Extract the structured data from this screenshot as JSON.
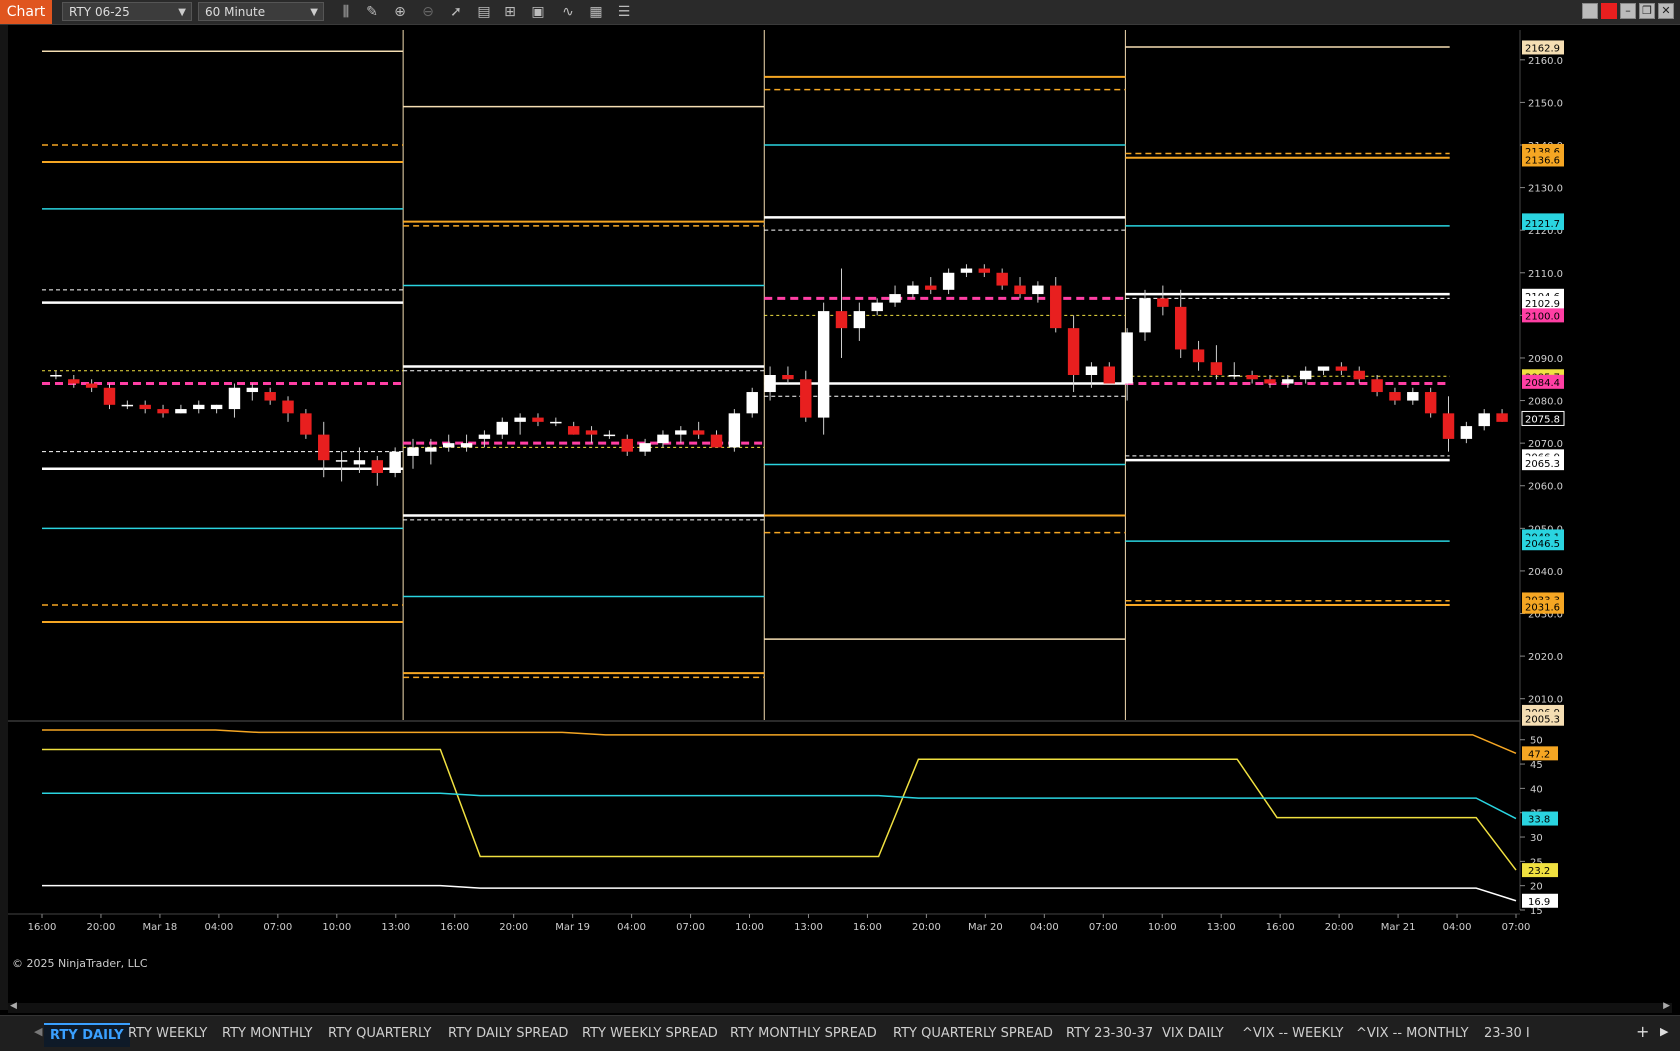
{
  "app": {
    "title": "Chart"
  },
  "toolbar": {
    "instrument": "RTY 06-25",
    "interval": "60 Minute",
    "icons": [
      "bar-type-icon",
      "draw-tool-icon",
      "zoom-in-icon",
      "zoom-out-icon",
      "pointer-icon",
      "data-box-icon",
      "properties-icon",
      "strategy-icon",
      "indicator-icon",
      "calculator-icon",
      "list-icon"
    ]
  },
  "window_buttons": [
    "restore-icon",
    "close-red-icon",
    "minimize-icon",
    "maximize-icon",
    "close-icon"
  ],
  "chart_data": {
    "type": "candlestick",
    "time_labels": [
      "16:00",
      "20:00",
      "Mar 18",
      "04:00",
      "07:00",
      "10:00",
      "13:00",
      "16:00",
      "20:00",
      "Mar 19",
      "04:00",
      "07:00",
      "10:00",
      "13:00",
      "16:00",
      "20:00",
      "Mar 20",
      "04:00",
      "07:00",
      "10:00",
      "13:00",
      "16:00",
      "20:00",
      "Mar 21",
      "04:00",
      "07:00"
    ],
    "price_axis": {
      "ticks": [
        2010,
        2020,
        2030,
        2040,
        2050,
        2060,
        2070,
        2080,
        2090,
        2100,
        2110,
        2120,
        2130,
        2140,
        2150,
        2160
      ],
      "range": [
        2005,
        2167
      ]
    },
    "price_markers": [
      {
        "label": "2162.9",
        "color": "#f5deb3"
      },
      {
        "label": "2138.6",
        "color": "#f5a623"
      },
      {
        "label": "2136.6",
        "color": "#f5a623"
      },
      {
        "label": "2122.3",
        "color": "#2ad4e0"
      },
      {
        "label": "2121.7",
        "color": "#2ad4e0"
      },
      {
        "label": "2104.6",
        "color": "#ffffff"
      },
      {
        "label": "2102.9",
        "color": "#ffffff"
      },
      {
        "label": "2100.0",
        "color": "#ff3fa4"
      },
      {
        "label": "2085.7",
        "color": "#f0e040"
      },
      {
        "label": "2084.4",
        "color": "#ff3fa4"
      },
      {
        "label": "2075.8",
        "color": "#000000"
      },
      {
        "label": "2066.9",
        "color": "#ffffff"
      },
      {
        "label": "2065.3",
        "color": "#ffffff"
      },
      {
        "label": "2048.1",
        "color": "#2ad4e0"
      },
      {
        "label": "2046.5",
        "color": "#2ad4e0"
      },
      {
        "label": "2033.3",
        "color": "#f5a623"
      },
      {
        "label": "2031.6",
        "color": "#f5a623"
      },
      {
        "label": "2006.9",
        "color": "#f5deb3"
      },
      {
        "label": "2005.3",
        "color": "#f5deb3"
      }
    ],
    "indicator_axis": {
      "ticks": [
        15,
        20,
        25,
        30,
        35,
        40,
        45,
        50
      ],
      "range": [
        15,
        52
      ]
    },
    "indicator_markers": [
      {
        "label": "47.2",
        "color": "#f5a623"
      },
      {
        "label": "33.8",
        "color": "#2ad4e0"
      },
      {
        "label": "23.2",
        "color": "#f0e040"
      },
      {
        "label": "16.9",
        "color": "#ffffff"
      }
    ],
    "sessions": [
      {
        "start": 0,
        "end": 0.245,
        "white_hi": 2103,
        "white_lo": 2064,
        "cyan_hi": 2125,
        "cyan_lo": 2050,
        "orange_hi": 2136,
        "orange_lo": 2028,
        "orange_dhi": 2140,
        "orange_dlo": 2032,
        "wheat_hi": 2162,
        "white_dhi": 2106,
        "white_dlo": 2068,
        "pink_hi": 2084,
        "yellow": 2087
      },
      {
        "start": 0.245,
        "end": 0.49,
        "white_hi": 2088,
        "white_lo": 2053,
        "cyan_hi": 2107,
        "cyan_lo": 2034,
        "orange_hi": 2122,
        "orange_lo": 2016,
        "orange_dhi": 2121,
        "orange_dlo": 2015,
        "wheat_hi": 2149,
        "white_dhi": 2087,
        "white_dlo": 2052,
        "pink_hi": 2070,
        "yellow": 2069
      },
      {
        "start": 0.49,
        "end": 0.735,
        "white_hi": 2123,
        "white_lo": 2084,
        "cyan_hi": 2140,
        "cyan_lo": 2065,
        "orange_hi": 2156,
        "orange_lo": 2053,
        "orange_dhi": 2153,
        "orange_dlo": 2049,
        "wheat_lo": 2024,
        "white_dhi": 2120,
        "white_dlo": 2081,
        "pink_hi": 2104,
        "yellow": 2100
      },
      {
        "start": 0.735,
        "end": 0.955,
        "white_hi": 2105,
        "white_lo": 2066,
        "cyan_hi": 2121,
        "cyan_lo": 2047,
        "orange_hi": 2137,
        "orange_lo": 2032,
        "orange_dhi": 2138,
        "orange_dlo": 2033,
        "wheat_hi": 2163,
        "white_dhi": 2104,
        "white_dlo": 2067,
        "pink_hi": 2084,
        "yellow": 2085.7
      }
    ],
    "candles": [
      [
        2086,
        2087,
        2085,
        2086
      ],
      [
        2085,
        2086,
        2083,
        2084
      ],
      [
        2084,
        2085,
        2082,
        2083
      ],
      [
        2083,
        2084,
        2078,
        2079
      ],
      [
        2079,
        2080,
        2078,
        2079
      ],
      [
        2079,
        2080,
        2077,
        2078
      ],
      [
        2078,
        2079,
        2076,
        2077
      ],
      [
        2077,
        2079,
        2077,
        2078
      ],
      [
        2078,
        2080,
        2077,
        2079
      ],
      [
        2078,
        2079,
        2077,
        2079
      ],
      [
        2078,
        2084,
        2076,
        2083
      ],
      [
        2082,
        2084,
        2080,
        2083
      ],
      [
        2082,
        2083,
        2079,
        2080
      ],
      [
        2080,
        2081,
        2075,
        2077
      ],
      [
        2077,
        2078,
        2071,
        2072
      ],
      [
        2072,
        2075,
        2062,
        2066
      ],
      [
        2066,
        2068,
        2061,
        2066
      ],
      [
        2065,
        2069,
        2063,
        2066
      ],
      [
        2066,
        2067,
        2060,
        2063
      ],
      [
        2063,
        2069,
        2062,
        2068
      ],
      [
        2067,
        2071,
        2064,
        2069
      ],
      [
        2068,
        2071,
        2065,
        2069
      ],
      [
        2069,
        2072,
        2068,
        2070
      ],
      [
        2069,
        2072,
        2068,
        2070
      ],
      [
        2071,
        2073,
        2069,
        2072
      ],
      [
        2072,
        2076,
        2071,
        2075
      ],
      [
        2075,
        2077,
        2072,
        2076
      ],
      [
        2076,
        2077,
        2074,
        2075
      ],
      [
        2075,
        2076,
        2074,
        2075
      ],
      [
        2074,
        2075,
        2072,
        2072
      ],
      [
        2073,
        2074,
        2070,
        2072
      ],
      [
        2072,
        2073,
        2071,
        2072
      ],
      [
        2071,
        2072,
        2067,
        2068
      ],
      [
        2068,
        2071,
        2067,
        2070
      ],
      [
        2070,
        2073,
        2069,
        2072
      ],
      [
        2072,
        2074,
        2070,
        2073
      ],
      [
        2073,
        2075,
        2071,
        2072
      ],
      [
        2072,
        2073,
        2069,
        2069
      ],
      [
        2069,
        2078,
        2068,
        2077
      ],
      [
        2077,
        2083,
        2076,
        2082
      ],
      [
        2082,
        2088,
        2080,
        2086
      ],
      [
        2086,
        2088,
        2084,
        2085
      ],
      [
        2085,
        2087,
        2075,
        2076
      ],
      [
        2076,
        2103,
        2072,
        2101
      ],
      [
        2101,
        2111,
        2090,
        2097
      ],
      [
        2097,
        2103,
        2094,
        2101
      ],
      [
        2101,
        2104,
        2100,
        2103
      ],
      [
        2103,
        2107,
        2102,
        2105
      ],
      [
        2105,
        2108,
        2104,
        2107
      ],
      [
        2107,
        2109,
        2105,
        2106
      ],
      [
        2106,
        2111,
        2105,
        2110
      ],
      [
        2110,
        2112,
        2109,
        2111
      ],
      [
        2111,
        2112,
        2109,
        2110
      ],
      [
        2110,
        2111,
        2106,
        2107
      ],
      [
        2107,
        2109,
        2104,
        2105
      ],
      [
        2105,
        2108,
        2103,
        2107
      ],
      [
        2107,
        2109,
        2096,
        2097
      ],
      [
        2097,
        2100,
        2082,
        2086
      ],
      [
        2086,
        2089,
        2083,
        2088
      ],
      [
        2088,
        2089,
        2084,
        2084
      ],
      [
        2084,
        2097,
        2080,
        2096
      ],
      [
        2096,
        2106,
        2094,
        2104
      ],
      [
        2104,
        2107,
        2100,
        2102
      ],
      [
        2102,
        2106,
        2090,
        2092
      ],
      [
        2092,
        2094,
        2087,
        2089
      ],
      [
        2089,
        2093,
        2085,
        2086
      ],
      [
        2086,
        2089,
        2085,
        2086
      ],
      [
        2086,
        2087,
        2084,
        2085
      ],
      [
        2085,
        2086,
        2083,
        2084
      ],
      [
        2084,
        2086,
        2083,
        2085
      ],
      [
        2085,
        2088,
        2084,
        2087
      ],
      [
        2087,
        2088,
        2086,
        2088
      ],
      [
        2088,
        2089,
        2086,
        2087
      ],
      [
        2087,
        2088,
        2084,
        2085
      ],
      [
        2085,
        2086,
        2081,
        2082
      ],
      [
        2082,
        2083,
        2079,
        2080
      ],
      [
        2080,
        2083,
        2079,
        2082
      ],
      [
        2082,
        2083,
        2076,
        2077
      ],
      [
        2077,
        2081,
        2068,
        2071
      ],
      [
        2071,
        2075,
        2070,
        2074
      ],
      [
        2074,
        2078,
        2073,
        2077
      ],
      [
        2077,
        2078,
        2075,
        2075
      ]
    ],
    "indicator_series": [
      {
        "color": "#f5a623",
        "values": [
          52,
          52,
          52,
          52,
          52,
          51.5,
          51.5,
          51.5,
          51.5,
          51.5,
          51.5,
          51.5,
          51.5,
          51,
          51,
          51,
          51,
          51,
          51,
          51,
          51,
          51,
          51,
          51,
          51,
          51,
          51,
          51,
          51,
          51,
          51,
          51,
          51,
          51,
          47.2
        ]
      },
      {
        "color": "#f0e040",
        "values": [
          48,
          48,
          48,
          48,
          48,
          48,
          48,
          48,
          48,
          48,
          48,
          26,
          26,
          26,
          26,
          26,
          26,
          26,
          26,
          26,
          26,
          26,
          46,
          46,
          46,
          46,
          46,
          46,
          46,
          46,
          46,
          34,
          34,
          34,
          34,
          34,
          34,
          23.2
        ]
      },
      {
        "color": "#2ad4e0",
        "values": [
          39,
          39,
          39,
          39,
          39,
          39,
          39,
          39,
          39,
          39,
          39,
          38.5,
          38.5,
          38.5,
          38.5,
          38.5,
          38.5,
          38.5,
          38.5,
          38.5,
          38.5,
          38.5,
          38,
          38,
          38,
          38,
          38,
          38,
          38,
          38,
          38,
          38,
          38,
          38,
          38,
          38,
          38,
          33.8
        ]
      },
      {
        "color": "#ffffff",
        "values": [
          20,
          20,
          20,
          20,
          20,
          20,
          20,
          20,
          20,
          20,
          20,
          19.5,
          19.5,
          19.5,
          19.5,
          19.5,
          19.5,
          19.5,
          19.5,
          19.5,
          19.5,
          19.5,
          19.5,
          19.5,
          19.5,
          19.5,
          19.5,
          19.5,
          19.5,
          19.5,
          19.5,
          19.5,
          19.5,
          19.5,
          19.5,
          19.5,
          19.5,
          16.9
        ]
      }
    ]
  },
  "copyright": "© 2025 NinjaTrader, LLC",
  "tabs": [
    {
      "label": "RTY DAILY",
      "active": true
    },
    {
      "label": "RTY WEEKLY"
    },
    {
      "label": "RTY MONTHLY"
    },
    {
      "label": "RTY QUARTERLY"
    },
    {
      "label": "RTY DAILY SPREAD"
    },
    {
      "label": "RTY WEEKLY SPREAD"
    },
    {
      "label": "RTY MONTHLY SPREAD"
    },
    {
      "label": "RTY QUARTERLY SPREAD"
    },
    {
      "label": "RTY 23-30-37"
    },
    {
      "label": "VIX DAILY"
    },
    {
      "label": "^VIX -- WEEKLY"
    },
    {
      "label": "^VIX -- MONTHLY"
    },
    {
      "label": "23-30 I"
    }
  ]
}
